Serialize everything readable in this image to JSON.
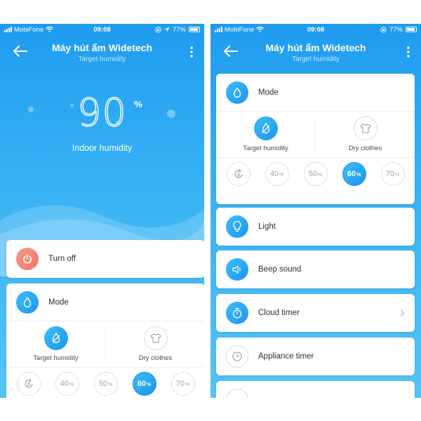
{
  "status_bar": {
    "carrier": "MobiFone",
    "time": "09:08",
    "battery_left": "77%",
    "battery_right": "77%",
    "battery_level": 0.77
  },
  "header": {
    "title": "Máy hút ẩm Widetech",
    "subtitle": "Target humidity",
    "back_icon": "back-arrow-icon",
    "more_icon": "more-vertical-icon"
  },
  "hero": {
    "value": "90",
    "unit": "%",
    "label": "Indoor humidity"
  },
  "power": {
    "label": "Turn off",
    "icon": "power-icon",
    "color": "#ee7663"
  },
  "mode": {
    "label": "Mode",
    "icon": "drop-icon",
    "options": [
      {
        "label": "Target humidity",
        "icon": "drop-slash-icon",
        "selected": true
      },
      {
        "label": "Dry clothes",
        "icon": "shirt-icon",
        "selected": false
      }
    ]
  },
  "humidity_levels": {
    "items": [
      {
        "value": "40",
        "unit": "%"
      },
      {
        "value": "50",
        "unit": "%"
      },
      {
        "value": "60",
        "unit": "%",
        "selected": true
      },
      {
        "value": "70",
        "unit": "%"
      }
    ],
    "auto_icon": "auto-cycle-icon"
  },
  "settings": [
    {
      "label": "Light",
      "icon": "bulb-icon"
    },
    {
      "label": "Beep sound",
      "icon": "speaker-icon"
    },
    {
      "label": "Cloud timer",
      "icon": "stopwatch-icon"
    },
    {
      "label": "Appliance timer",
      "icon": "clock-icon"
    }
  ],
  "colors": {
    "accent": "#1f95ee",
    "background_top": "#1f9bf0",
    "card": "#ffffff"
  }
}
